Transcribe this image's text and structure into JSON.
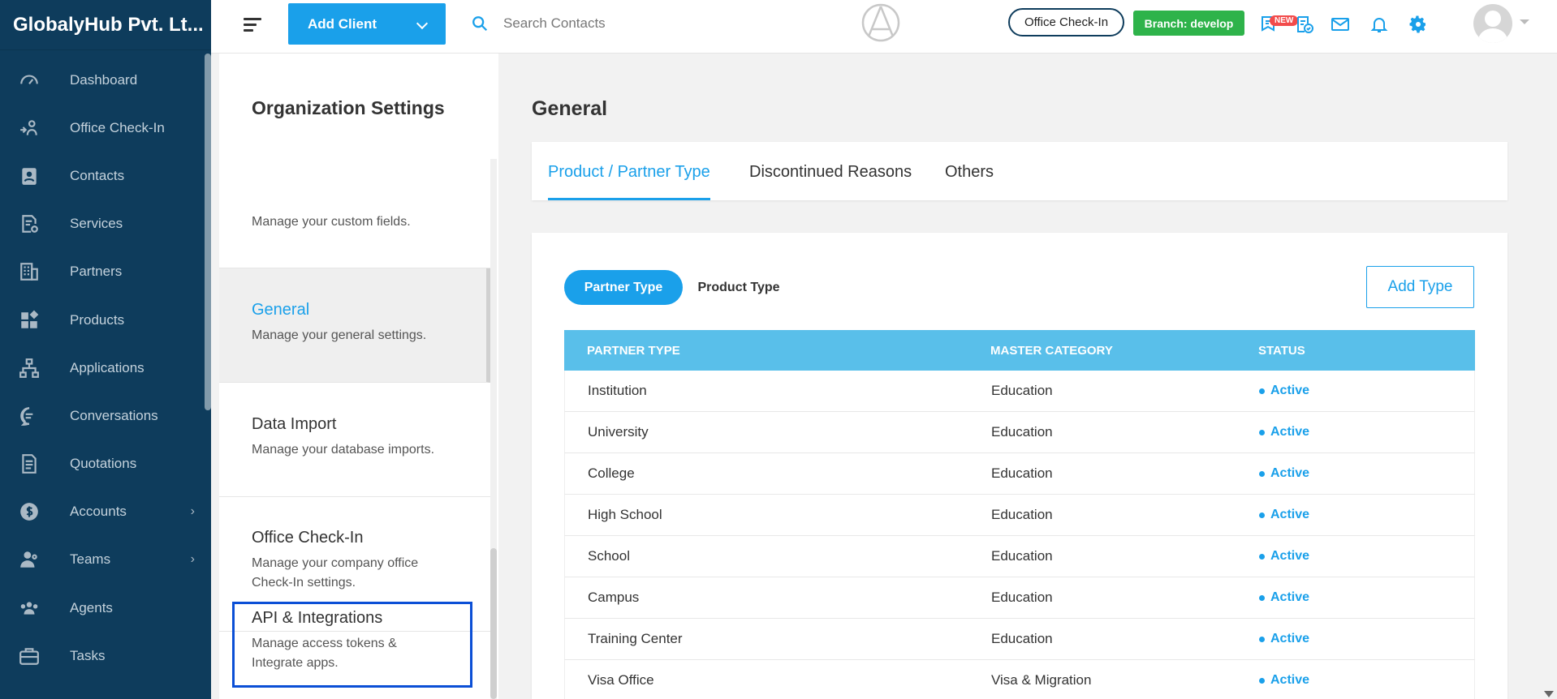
{
  "brand": "GlobalyHub Pvt. Lt...",
  "nav": [
    {
      "label": "Dashboard",
      "icon": "gauge-icon"
    },
    {
      "label": "Office Check-In",
      "icon": "checkin-icon"
    },
    {
      "label": "Contacts",
      "icon": "contacts-icon"
    },
    {
      "label": "Services",
      "icon": "services-icon"
    },
    {
      "label": "Partners",
      "icon": "building-icon"
    },
    {
      "label": "Products",
      "icon": "products-icon"
    },
    {
      "label": "Applications",
      "icon": "flow-icon"
    },
    {
      "label": "Conversations",
      "icon": "chat-icon"
    },
    {
      "label": "Quotations",
      "icon": "document-icon"
    },
    {
      "label": "Accounts",
      "icon": "dollar-icon"
    },
    {
      "label": "Teams",
      "icon": "team-icon"
    },
    {
      "label": "Agents",
      "icon": "agents-icon"
    },
    {
      "label": "Tasks",
      "icon": "briefcase-icon"
    }
  ],
  "topbar": {
    "add_client": "Add Client",
    "search_placeholder": "Search Contacts",
    "office_checkin": "Office Check-In",
    "branch": "Branch: develop",
    "new_badge": "NEW"
  },
  "settings": {
    "title": "Organization Settings",
    "items": [
      {
        "name": "",
        "desc": "Manage your custom fields."
      },
      {
        "name": "General",
        "desc": "Manage your general settings."
      },
      {
        "name": "Data Import",
        "desc": "Manage your database imports."
      },
      {
        "name": "Office Check-In",
        "desc": "Manage your company office Check-In settings."
      },
      {
        "name": "API & Integrations",
        "desc": "Manage access tokens & Integrate apps."
      }
    ]
  },
  "main": {
    "title": "General",
    "tabs": [
      "Product / Partner Type",
      "Discontinued Reasons",
      "Others"
    ],
    "subtabs": [
      "Partner Type",
      "Product Type"
    ],
    "add_type": "Add Type",
    "columns": [
      "PARTNER TYPE",
      "MASTER CATEGORY",
      "STATUS"
    ],
    "rows": [
      {
        "type": "Institution",
        "category": "Education",
        "status": "Active"
      },
      {
        "type": "University",
        "category": "Education",
        "status": "Active"
      },
      {
        "type": "College",
        "category": "Education",
        "status": "Active"
      },
      {
        "type": "High School",
        "category": "Education",
        "status": "Active"
      },
      {
        "type": "School",
        "category": "Education",
        "status": "Active"
      },
      {
        "type": "Campus",
        "category": "Education",
        "status": "Active"
      },
      {
        "type": "Training Center",
        "category": "Education",
        "status": "Active"
      },
      {
        "type": "Visa Office",
        "category": "Visa & Migration",
        "status": "Active"
      }
    ]
  },
  "colors": {
    "sidebar": "#0e3c5c",
    "accent": "#1aa0ea",
    "table_header": "#59bfea",
    "branch": "#2eb34a",
    "focus": "#0b4fd6"
  }
}
